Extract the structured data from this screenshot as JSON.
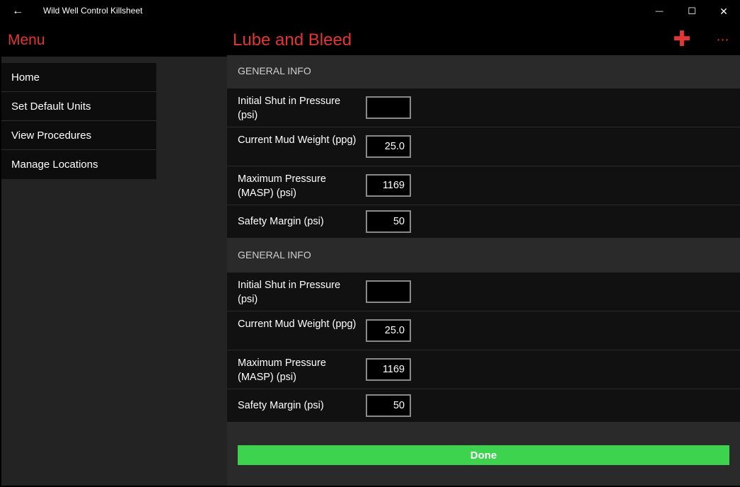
{
  "window": {
    "back_icon": "←",
    "title": "Wild Well Control Killsheet",
    "minimize_icon": "—",
    "maximize_icon": "☐",
    "close_icon": "✕"
  },
  "header": {
    "menu_title": "Menu",
    "page_title": "Lube and Bleed",
    "add_icon": "✚",
    "more_icon": "⋯"
  },
  "menu": {
    "items": [
      {
        "label": "Home"
      },
      {
        "label": "Set Default Units"
      },
      {
        "label": "View Procedures"
      },
      {
        "label": "Manage Locations"
      }
    ]
  },
  "sections": [
    {
      "header": "GENERAL INFO",
      "fields": [
        {
          "label": "Initial Shut in Pressure (psi)",
          "value": ""
        },
        {
          "label": "Current Mud Weight (ppg)",
          "value": "25.0"
        },
        {
          "label": "Maximum Pressure (MASP) (psi)",
          "value": "1169"
        },
        {
          "label": "Safety Margin (psi)",
          "value": "50"
        }
      ]
    },
    {
      "header": "GENERAL INFO",
      "fields": [
        {
          "label": "Initial Shut in Pressure (psi)",
          "value": ""
        },
        {
          "label": "Current Mud Weight (ppg)",
          "value": "25.0"
        },
        {
          "label": "Maximum Pressure (MASP) (psi)",
          "value": "1169"
        },
        {
          "label": "Safety Margin (psi)",
          "value": "50"
        }
      ]
    }
  ],
  "done_label": "Done",
  "colors": {
    "accent": "#e33535",
    "done": "#3ed34f",
    "background": "#000000"
  }
}
